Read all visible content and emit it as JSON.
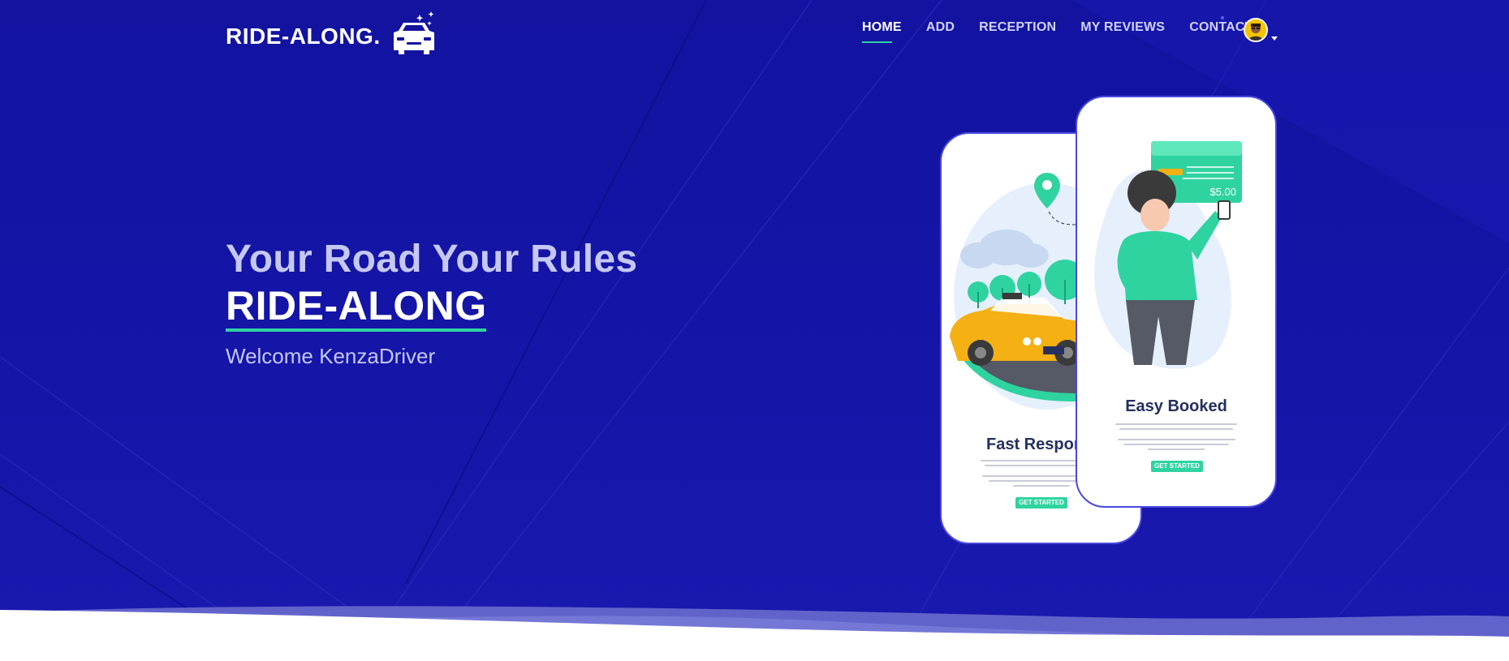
{
  "brand": {
    "name": "RIDE-ALONG.",
    "icon": "car-icon"
  },
  "nav": {
    "items": [
      {
        "label": "HOME",
        "active": true
      },
      {
        "label": "ADD",
        "active": false
      },
      {
        "label": "RECEPTION",
        "active": false
      },
      {
        "label": "MY REVIEWS",
        "active": false
      },
      {
        "label": "CONTACT",
        "active": false
      }
    ],
    "avatar_icon": "user-avatar-icon"
  },
  "hero": {
    "headline": "Your Road Your Rules",
    "brand_big": "RIDE-ALONG",
    "welcome": "Welcome KenzaDriver"
  },
  "cards": [
    {
      "title": "Fast Respon",
      "cta": "GET STARTED",
      "illustration": "taxi-map-illustration"
    },
    {
      "title": "Easy Booked",
      "cta": "GET STARTED",
      "price": "$5.00",
      "illustration": "person-phone-illustration"
    }
  ],
  "colors": {
    "background": "#1313a0",
    "accent": "#2fd3a0",
    "nav_text": "#cfd2ff",
    "headline": "#c5c8f3",
    "card_title": "#24305e"
  }
}
